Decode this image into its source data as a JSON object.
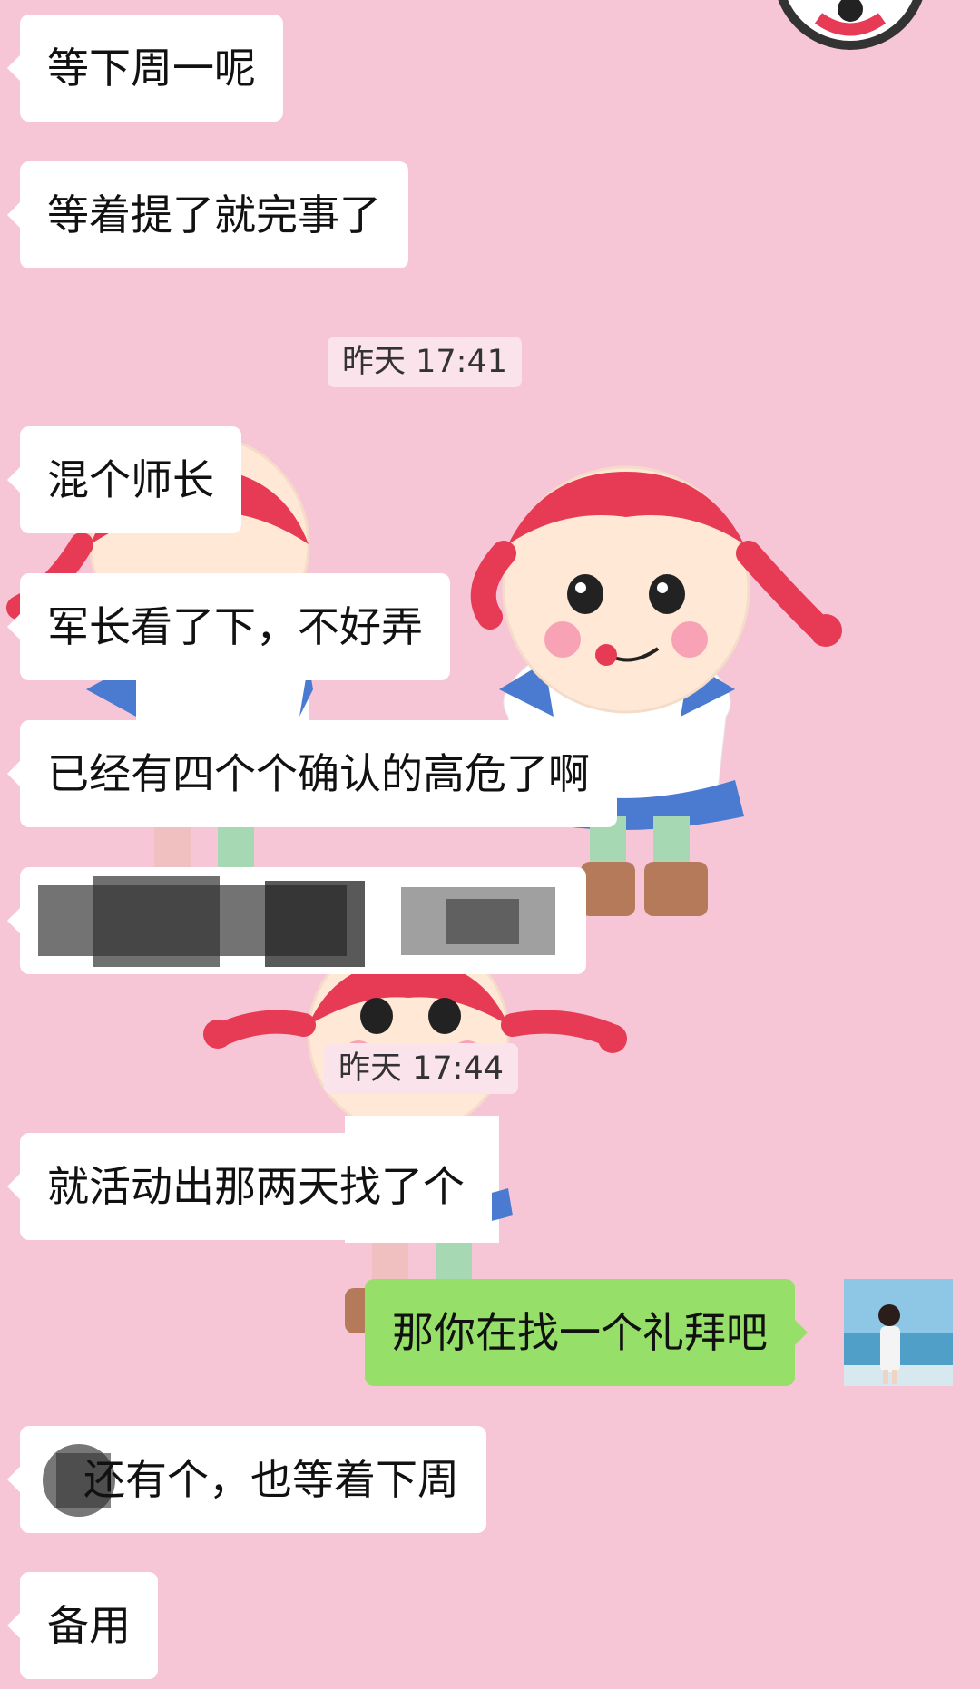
{
  "timestamps": [
    "昨天 17:41",
    "昨天 17:44"
  ],
  "messages": [
    {
      "text": "等下周一呢",
      "side": "in"
    },
    {
      "text": "等着提了就完事了",
      "side": "in"
    },
    {
      "text": "混个师长",
      "side": "in"
    },
    {
      "text": "军长看了下，不好弄",
      "side": "in"
    },
    {
      "text": "已经有四个个确认的高危了啊",
      "side": "in"
    },
    {
      "text": "",
      "side": "in",
      "redacted": true
    },
    {
      "text": "就活动出那两天找了个",
      "side": "in"
    },
    {
      "text": "那你在找一个礼拜吧",
      "side": "out"
    },
    {
      "text": "还有个，也等着下周",
      "side": "in",
      "partially_redacted": true
    },
    {
      "text": "备用",
      "side": "in"
    }
  ],
  "colors": {
    "background": "#f7c6d6",
    "incoming_bubble": "#ffffff",
    "outgoing_bubble": "#96e06a",
    "timestamp_bg": "#fbe3ec"
  },
  "icons": [
    "sender-avatar",
    "chat-wallpaper"
  ]
}
